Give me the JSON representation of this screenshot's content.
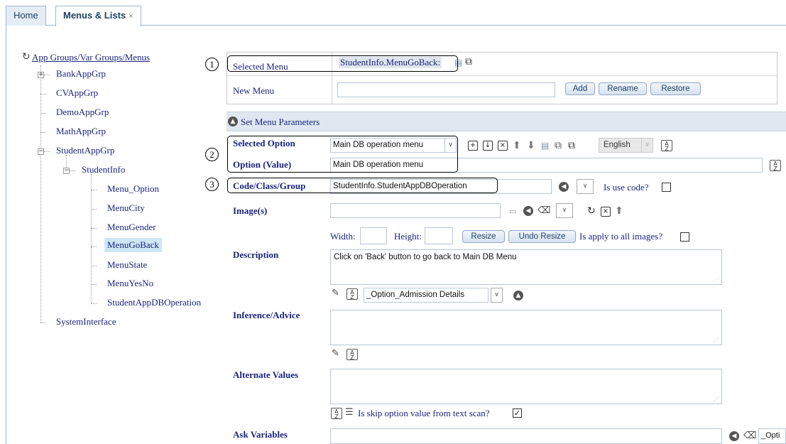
{
  "tabs": [
    {
      "label": "Home"
    },
    {
      "label": "Menus & Lists",
      "close": "×"
    }
  ],
  "tree": {
    "root": "App Groups/Var Groups/Menus",
    "groups": [
      "BankAppGrp",
      "CVAppGrp",
      "DemoAppGrp",
      "MathAppGrp",
      "StudentAppGrp"
    ],
    "student_info": "StudentInfo",
    "menus": [
      "Menu_Option",
      "MenuCity",
      "MenuGender",
      "MenuGoBack",
      "MenuState",
      "MenuYesNo",
      "StudentAppDBOperation"
    ],
    "system_interface": "SystemInterface",
    "selected": "MenuGoBack"
  },
  "menu_panel": {
    "selected_menu_label": "Selected Menu",
    "selected_menu_value": "StudentInfo.MenuGoBack:",
    "new_menu_label": "New Menu",
    "new_menu_value": "",
    "add_button": "Add",
    "rename_button": "Rename",
    "restore_button": "Restore"
  },
  "params": {
    "section_title": "Set Menu Parameters",
    "selected_option_label": "Selected Option",
    "selected_option_value": "Main DB operation menu",
    "language": "English",
    "option_value_label": "Option (Value)",
    "option_value": "Main DB operation menu",
    "code_label": "Code/Class/Group",
    "code_value": "StudentInfo.StudentAppDBOperation",
    "is_use_code_label": "Is use code?",
    "images_label": "Image(s)",
    "width_label": "Width:",
    "height_label": "Height:",
    "resize_button": "Resize",
    "undo_resize_button": "Undo Resize",
    "apply_all_label": "Is apply to all images?",
    "description_label": "Description",
    "description_value": "Click on 'Back' button to go back to Main DB Menu",
    "description_option_select": "_Option_Admission Details",
    "inference_label": "Inference/Advice",
    "alternate_label": "Alternate Values",
    "skip_scan_label": "Is skip option value from text scan?",
    "skip_scan_checked": true,
    "ask_variables_label": "Ask Variables",
    "ask_variables_select": "_Opti"
  },
  "callouts": [
    "1",
    "2",
    "3"
  ]
}
